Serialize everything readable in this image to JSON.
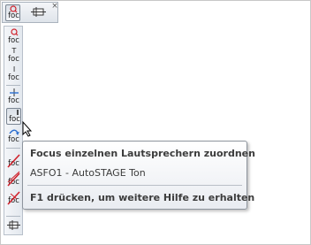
{
  "top_toolbar": {
    "button_label": "foc",
    "close_label": "×"
  },
  "toolbar": {
    "foc_label": "foc",
    "buttons": [
      {
        "name": "focus-speaker-q",
        "mark": "Q"
      },
      {
        "name": "focus-speaker-t",
        "mark": "T"
      },
      {
        "name": "focus-speaker-i",
        "mark": "I"
      },
      {
        "name": "focus-speaker-plus",
        "mark": "+"
      },
      {
        "name": "focus-single-speakers",
        "mark": "I"
      },
      {
        "name": "focus-rotate",
        "mark": "↷"
      },
      {
        "name": "focus-clear-1",
        "mark": "╱"
      },
      {
        "name": "focus-clear-2",
        "mark": "╱"
      },
      {
        "name": "focus-clear-3",
        "mark": "╱"
      }
    ]
  },
  "tooltip": {
    "title": "Focus einzelnen Lautsprechern zuordnen",
    "body": "ASFO1 - AutoSTAGE Ton",
    "help": "F1 drücken, um weitere Hilfe zu erhalten"
  },
  "colors": {
    "accent_red": "#d0202a",
    "toolbar_bg": "#e6ebf0"
  }
}
